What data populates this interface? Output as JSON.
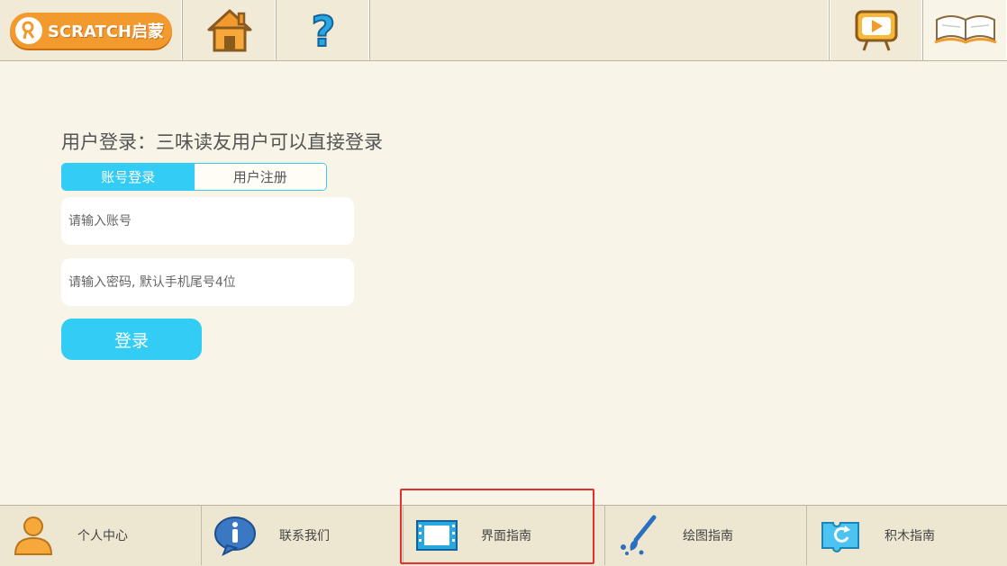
{
  "header": {
    "logo_text": "SCRATCH启蒙",
    "icons": {
      "home": "home-icon",
      "help": "help-icon",
      "video": "video-icon",
      "book": "book-icon"
    }
  },
  "login": {
    "title": "用户登录：三味读友用户可以直接登录",
    "tabs": [
      {
        "label": "账号登录",
        "active": true
      },
      {
        "label": "用户注册",
        "active": false
      }
    ],
    "account_placeholder": "请输入账号",
    "password_placeholder": "请输入密码, 默认手机尾号4位",
    "submit_label": "登录"
  },
  "footer": {
    "items": [
      {
        "label": "个人中心",
        "icon": "person-icon"
      },
      {
        "label": "联系我们",
        "icon": "info-icon"
      },
      {
        "label": "界面指南",
        "icon": "film-icon"
      },
      {
        "label": "绘图指南",
        "icon": "paintbrush-icon"
      },
      {
        "label": "积木指南",
        "icon": "block-icon"
      }
    ]
  },
  "colors": {
    "accent": "#33ccf5",
    "logo_orange": "#f39a2e",
    "highlight": "#e53030"
  }
}
